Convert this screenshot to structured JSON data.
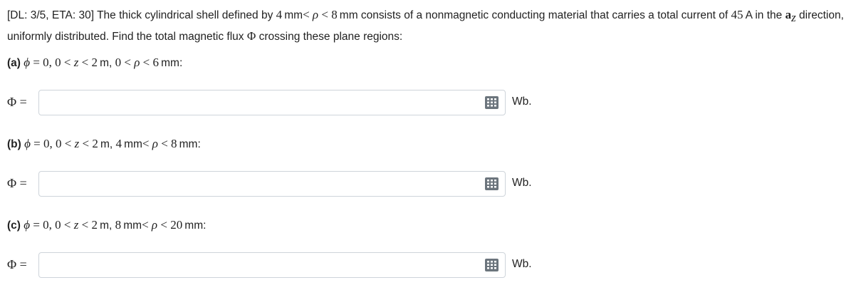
{
  "problem": {
    "prefix": "[DL: 3/5, ETA: 30] The thick cylindrical shell defined by ",
    "r_inner": "4",
    "r_outer": "8",
    "unit_mm": "mm",
    "text_mid": " consists of a nonmagnetic conducting material that carries a total current of ",
    "current": "45",
    "current_unit": "A",
    "text_in": " in the ",
    "dir_vec": "a",
    "dir_sub": "z",
    "text_end": " direction, uniformly distributed. Find the total magnetic flux ",
    "phi": "Φ",
    "text_tail": " crossing these plane regions:"
  },
  "parts": [
    {
      "label": "(a)",
      "phi_val": "0",
      "z_lo": "0",
      "z_hi": "2",
      "z_unit": "m",
      "rho_lo": "0",
      "rho_lo_unit": "",
      "rho_hi": "6",
      "rho_unit": "mm",
      "answer_label": "Φ",
      "answer_value": "",
      "unit": "Wb."
    },
    {
      "label": "(b)",
      "phi_val": "0",
      "z_lo": "0",
      "z_hi": "2",
      "z_unit": "m",
      "rho_lo": "4",
      "rho_lo_unit": "mm",
      "rho_hi": "8",
      "rho_unit": "mm",
      "answer_label": "Φ",
      "answer_value": "",
      "unit": "Wb."
    },
    {
      "label": "(c)",
      "phi_val": "0",
      "z_lo": "0",
      "z_hi": "2",
      "z_unit": "m",
      "rho_lo": "8",
      "rho_lo_unit": "mm",
      "rho_hi": "20",
      "rho_unit": "mm",
      "answer_label": "Φ",
      "answer_value": "",
      "unit": "Wb."
    }
  ],
  "icons": {
    "keypad": "keypad-icon"
  },
  "colors": {
    "text": "#222222",
    "border": "#ced4da",
    "icon": "#6c757d"
  }
}
